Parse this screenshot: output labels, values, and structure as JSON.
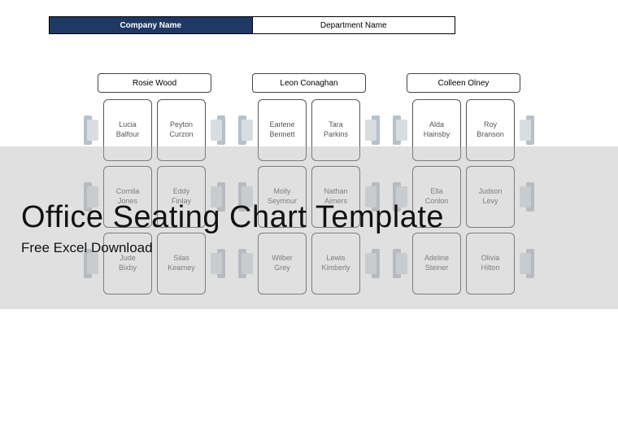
{
  "header": {
    "company_label": "Company Name",
    "department_label": "Department Name"
  },
  "overlay": {
    "title": "Office Seating Chart Template",
    "subtitle": "Free Excel Download"
  },
  "clusters": [
    {
      "title": "Rosie Wood",
      "seats": [
        {
          "first": "Lucia",
          "last": "Balfour"
        },
        {
          "first": "Peyton",
          "last": "Curzon"
        },
        {
          "first": "Cornila",
          "last": "Jones"
        },
        {
          "first": "Eddy",
          "last": "Finlay"
        },
        {
          "first": "Jude",
          "last": "Bixby"
        },
        {
          "first": "Silas",
          "last": "Kearney"
        }
      ]
    },
    {
      "title": "Leon Conaghan",
      "seats": [
        {
          "first": "Earlene",
          "last": "Bennett"
        },
        {
          "first": "Tara",
          "last": "Parkins"
        },
        {
          "first": "Molly",
          "last": "Seymour"
        },
        {
          "first": "Nathan",
          "last": "Aimers"
        },
        {
          "first": "Wilber",
          "last": "Grey"
        },
        {
          "first": "Lewis",
          "last": "Kimberly"
        }
      ]
    },
    {
      "title": "Colleen Olney",
      "seats": [
        {
          "first": "Alda",
          "last": "Hainsby"
        },
        {
          "first": "Roy",
          "last": "Branson"
        },
        {
          "first": "Ella",
          "last": "Conlon"
        },
        {
          "first": "Judson",
          "last": "Levy"
        },
        {
          "first": "Adeline",
          "last": "Steiner"
        },
        {
          "first": "Olivia",
          "last": "Hilton"
        }
      ]
    }
  ]
}
